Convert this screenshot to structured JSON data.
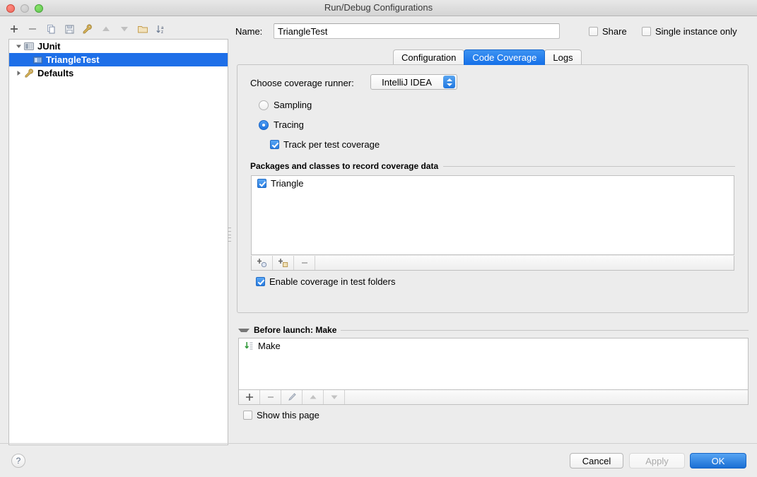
{
  "window": {
    "title": "Run/Debug Configurations",
    "traffic_lights": [
      "close",
      "minimize",
      "zoom"
    ]
  },
  "left_panel": {
    "toolbar": [
      {
        "name": "add-configuration-button",
        "icon": "plus-icon"
      },
      {
        "name": "remove-configuration-button",
        "icon": "minus-icon"
      },
      {
        "name": "copy-configuration-button",
        "icon": "copy-icon"
      },
      {
        "name": "save-configuration-button",
        "icon": "save-icon"
      },
      {
        "name": "edit-defaults-button",
        "icon": "wrench-icon"
      },
      {
        "name": "move-up-button",
        "icon": "arrow-up-icon"
      },
      {
        "name": "move-down-button",
        "icon": "arrow-down-icon"
      },
      {
        "name": "move-into-folder-button",
        "icon": "folder-icon"
      },
      {
        "name": "sort-configurations-button",
        "icon": "sort-az-icon"
      }
    ],
    "tree": [
      {
        "label": "JUnit",
        "icon": "junit-icon",
        "expanded": true,
        "level": 0,
        "selected": false
      },
      {
        "label": "TriangleTest",
        "icon": "test-class-icon",
        "expanded": null,
        "level": 1,
        "selected": true
      },
      {
        "label": "Defaults",
        "icon": "wrench-icon",
        "expanded": false,
        "level": 0,
        "selected": false
      }
    ]
  },
  "right_panel": {
    "name_label": "Name:",
    "name_value": "TriangleTest",
    "share": {
      "label": "Share",
      "checked": false
    },
    "single_instance": {
      "label": "Single instance only",
      "checked": false
    },
    "tabs": [
      {
        "label": "Configuration",
        "active": false
      },
      {
        "label": "Code Coverage",
        "active": true
      },
      {
        "label": "Logs",
        "active": false
      }
    ],
    "coverage": {
      "runner_label": "Choose coverage runner:",
      "runner_value": "IntelliJ IDEA",
      "sampling": {
        "label": "Sampling",
        "selected": false
      },
      "tracing": {
        "label": "Tracing",
        "selected": true
      },
      "track_per_test": {
        "label": "Track per test coverage",
        "checked": true
      },
      "packages_group_title": "Packages and classes to record coverage data",
      "packages": [
        {
          "label": "Triangle",
          "checked": true
        }
      ],
      "packages_toolbar": [
        {
          "name": "add-class-button",
          "icon": "add-class-icon"
        },
        {
          "name": "add-package-button",
          "icon": "add-package-icon"
        },
        {
          "name": "remove-pattern-button",
          "icon": "minus-icon"
        }
      ],
      "enable_test_folders": {
        "label": "Enable coverage in test folders",
        "checked": true
      }
    },
    "before_launch": {
      "title": "Before launch: Make",
      "expanded": true,
      "tasks": [
        {
          "label": "Make",
          "icon": "make-icon"
        }
      ],
      "toolbar": [
        {
          "name": "add-task-button",
          "icon": "plus-icon"
        },
        {
          "name": "remove-task-button",
          "icon": "minus-icon"
        },
        {
          "name": "edit-task-button",
          "icon": "pencil-icon"
        },
        {
          "name": "move-task-up-button",
          "icon": "arrow-up-icon"
        },
        {
          "name": "move-task-down-button",
          "icon": "arrow-down-icon"
        }
      ],
      "show_this_page": {
        "label": "Show this page",
        "checked": false
      }
    }
  },
  "footer": {
    "help_label": "?",
    "cancel_label": "Cancel",
    "apply_label": "Apply",
    "apply_enabled": false,
    "ok_label": "OK"
  },
  "colors": {
    "accent_blue": "#1e6fe8",
    "tab_active": "#2a7fe8",
    "window_bg": "#ececec",
    "list_bg": "#ffffff",
    "make_icon_green": "#3b9e43"
  }
}
